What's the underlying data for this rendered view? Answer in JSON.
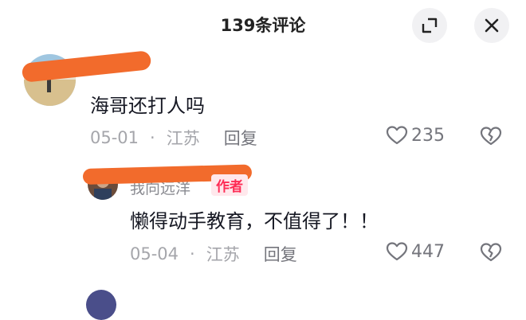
{
  "header": {
    "title": "139条评论"
  },
  "comments": [
    {
      "username": "",
      "text": "海哥还打人吗",
      "date": "05-01",
      "location": "江苏",
      "reply_label": "回复",
      "likes": "235"
    },
    {
      "username": "我向远洋",
      "author_badge": "作者",
      "text": "懒得动手教育，不值得了！！",
      "date": "05-04",
      "location": "江苏",
      "reply_label": "回复",
      "likes": "447"
    }
  ],
  "meta": {
    "separator": "·"
  },
  "colors": {
    "author_badge": "#fe2c55",
    "redaction": "#f26b2c"
  },
  "icons": [
    "expand-icon",
    "close-icon",
    "heart-icon",
    "broken-heart-icon"
  ]
}
